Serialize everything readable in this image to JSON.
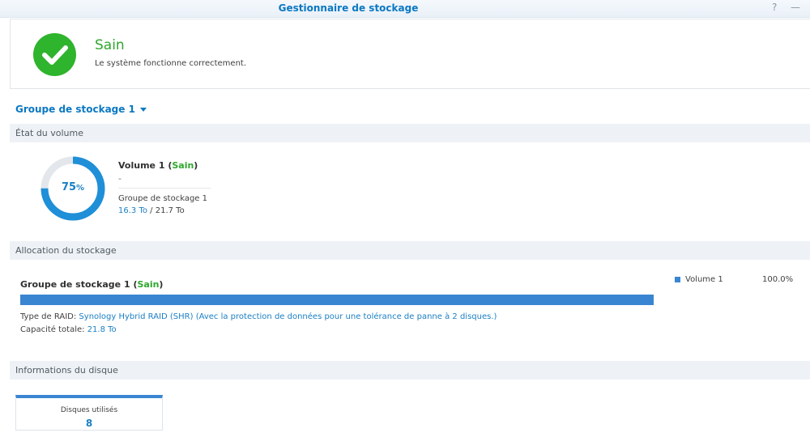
{
  "window": {
    "title": "Gestionnaire de stockage",
    "help_glyph": "?",
    "minimize_glyph": "—"
  },
  "status": {
    "title": "Sain",
    "description": "Le système fonctionne correctement.",
    "icon": "check-circle-icon",
    "color": "#2fb42d"
  },
  "group_selector": {
    "label": "Groupe de stockage 1"
  },
  "volume_section": {
    "header": "État du volume",
    "usage_percent": 75,
    "usage_label": "75",
    "usage_unit": "%",
    "volume_name": "Volume 1",
    "volume_status": "Sain",
    "volume_desc": "-",
    "group_name": "Groupe de stockage 1",
    "used": "16.3 To",
    "separator": " / ",
    "total": "21.7 To"
  },
  "allocation_section": {
    "header": "Allocation du stockage",
    "group_name": "Groupe de stockage 1",
    "group_status": "Sain",
    "bar_fill_fraction": 1.0,
    "bar_color": "#3a85d2",
    "raid_label": "Type de RAID: ",
    "raid_value": "Synology Hybrid RAID (SHR) (Avec la protection de données pour une tolérance de panne à 2 disques.)",
    "capacity_label": "Capacité totale: ",
    "capacity_value": "21.8 To",
    "legend": {
      "name": "Volume 1",
      "percent": "100.0%"
    }
  },
  "disk_section": {
    "header": "Informations du disque",
    "disks_used_label": "Disques utilisés",
    "disks_used_count": "8"
  }
}
